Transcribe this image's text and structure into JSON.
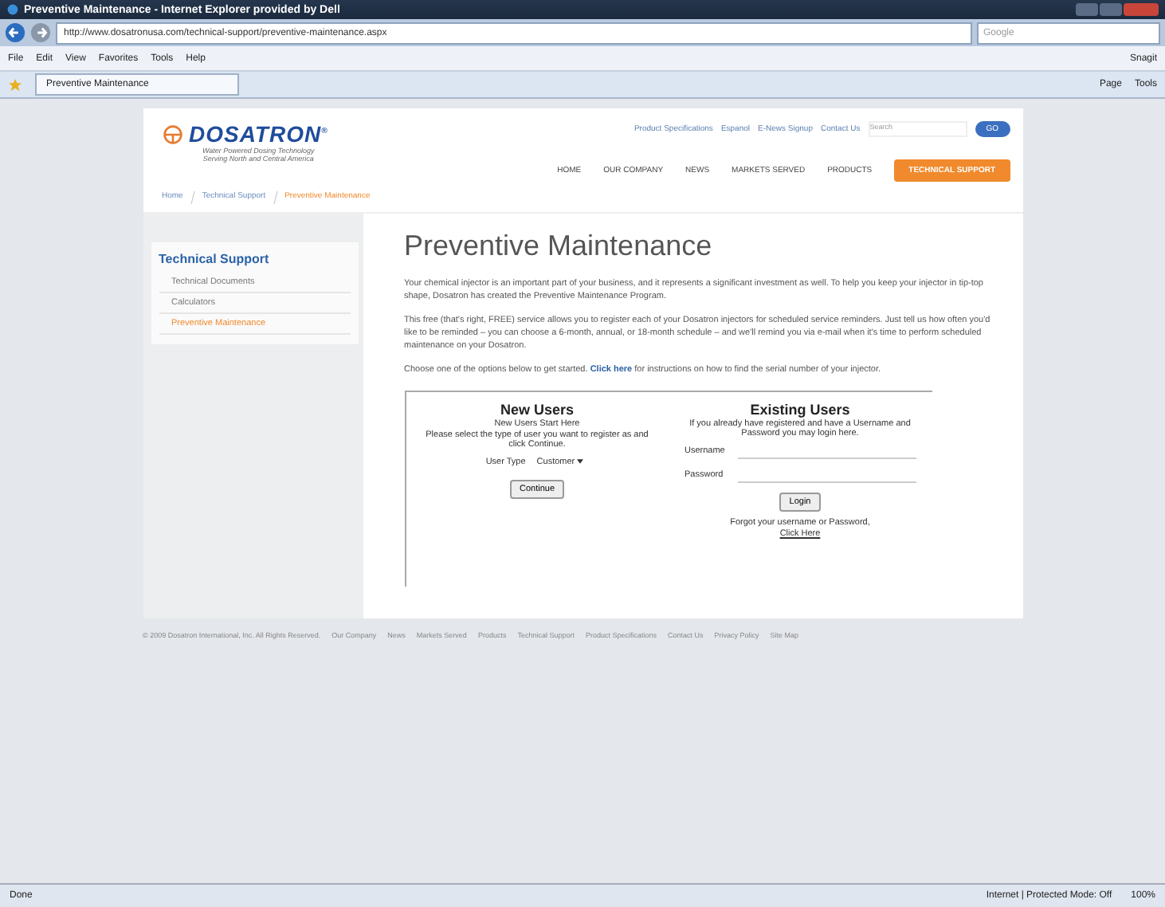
{
  "window": {
    "title": "Preventive Maintenance - Internet Explorer provided by Dell"
  },
  "address_bar": {
    "url": "http://www.dosatronusa.com/technical-support/preventive-maintenance.aspx",
    "search_placeholder": "Google"
  },
  "menu": [
    "File",
    "Edit",
    "View",
    "Favorites",
    "Tools",
    "Help"
  ],
  "menu_right": [
    "Snagit"
  ],
  "tab": {
    "label": "Preventive Maintenance"
  },
  "command_bar": [
    "Page",
    "Tools"
  ],
  "site": {
    "logo": "DOSATRON",
    "logo_mark": "®",
    "tagline_1": "Water Powered Dosing Technology",
    "tagline_2": "Serving North and Central America",
    "top_links": [
      "Product Specifications",
      "Espanol",
      "E-News Signup",
      "Contact Us"
    ],
    "search_placeholder": "Search",
    "search_button": "GO",
    "nav": [
      {
        "label": "HOME",
        "selected": false
      },
      {
        "label": "OUR COMPANY",
        "selected": false
      },
      {
        "label": "NEWS",
        "selected": false
      },
      {
        "label": "MARKETS SERVED",
        "selected": false
      },
      {
        "label": "PRODUCTS",
        "selected": false
      },
      {
        "label": "TECHNICAL SUPPORT",
        "selected": true
      }
    ],
    "breadcrumb": [
      {
        "label": "Home",
        "selected": false
      },
      {
        "label": "Technical Support",
        "selected": false
      },
      {
        "label": "Preventive Maintenance",
        "selected": true
      }
    ]
  },
  "sidebar": {
    "title": "Technical Support",
    "items": [
      {
        "label": "Technical Documents",
        "selected": false
      },
      {
        "label": "Calculators",
        "selected": false
      },
      {
        "label": "Preventive Maintenance",
        "selected": true
      }
    ]
  },
  "main": {
    "heading": "Preventive Maintenance",
    "paragraphs": [
      "Your chemical injector is an important part of your business, and it represents a significant investment as well. To help you keep your injector in tip-top shape, Dosatron has created the Preventive Maintenance Program.",
      "This free (that's right, FREE) service allows you to register each of your Dosatron injectors for scheduled service reminders. Just tell us how often you'd like to be reminded – you can choose a 6-month, annual, or 18-month schedule – and we'll remind you via e-mail when it's time to perform scheduled maintenance on your Dosatron."
    ],
    "choose_text": "Choose one of the options below to get started.",
    "choose_link": "Click here",
    "choose_after": "for instructions on how to find the serial number of your injector."
  },
  "new_users": {
    "title": "New Users",
    "subtitle": "New Users Start Here",
    "text": "Please select the type of user you want to register as and click Continue.",
    "user_type_label": "User Type",
    "user_type_value": "Customer",
    "button": "Continue"
  },
  "existing_users": {
    "title": "Existing Users",
    "text": "If you already have registered and have a Username and Password you may login here.",
    "username_label": "Username",
    "password_label": "Password",
    "button": "Login",
    "forgot": "Forgot your username or Password,",
    "forgot_link": "Click Here"
  },
  "footer": {
    "copyright": "© 2009 Dosatron International, Inc. All Rights Reserved.",
    "links": [
      "Our Company",
      "News",
      "Markets Served",
      "Products",
      "Technical Support",
      "Product Specifications",
      "Contact Us",
      "Privacy Policy",
      "Site Map"
    ]
  },
  "status_bar": {
    "left": "Done",
    "zone": "Internet | Protected Mode: Off",
    "zoom": "100%"
  }
}
